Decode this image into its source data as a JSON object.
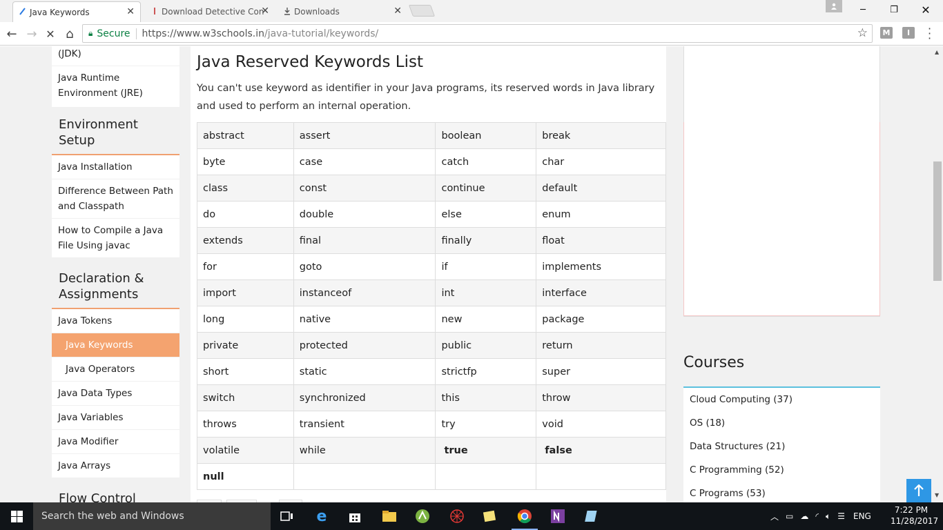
{
  "browser": {
    "tabs": [
      {
        "title": "Java Keywords",
        "active": true
      },
      {
        "title": "Download Detective Con",
        "active": false
      },
      {
        "title": "Downloads",
        "active": false
      }
    ],
    "security_label": "Secure",
    "url_host": "https://www.w3schools.in",
    "url_path": "/java-tutorial/keywords/",
    "extensions": [
      "M",
      "I"
    ]
  },
  "sidebar": {
    "top_items": [
      "(JDK)",
      "Java Runtime Environment (JRE)"
    ],
    "sections": [
      {
        "heading": "Environment Setup",
        "items": [
          "Java Installation",
          "Difference Between Path and Classpath",
          "How to Compile a Java File Using javac"
        ]
      },
      {
        "heading": "Declaration & Assignments",
        "items": [
          "Java Tokens",
          "Java Keywords",
          "Java Operators",
          "Java Data Types",
          "Java Variables",
          "Java Modifier",
          "Java Arrays"
        ]
      },
      {
        "heading": "Flow Control",
        "items": []
      }
    ]
  },
  "article": {
    "title": "Java Reserved Keywords List",
    "intro": "You can't use keyword as identifier in your Java programs, its reserved words in Java library and used to perform an internal operation.",
    "keywords_table": [
      [
        "abstract",
        "assert",
        "boolean",
        "break"
      ],
      [
        "byte",
        "case",
        "catch",
        "char"
      ],
      [
        "class",
        "const",
        "continue",
        "default"
      ],
      [
        "do",
        "double",
        "else",
        "enum"
      ],
      [
        "extends",
        "final",
        "finally",
        "float"
      ],
      [
        "for",
        "goto",
        "if",
        "implements"
      ],
      [
        "import",
        "instanceof",
        "int",
        "interface"
      ],
      [
        "long",
        "native",
        "new",
        "package"
      ],
      [
        "private",
        "protected",
        "public",
        "return"
      ],
      [
        "short",
        "static",
        "strictfp",
        "super"
      ],
      [
        "switch",
        "synchronized",
        "this",
        "throw"
      ],
      [
        "throws",
        "transient",
        "try",
        "void"
      ],
      [
        "volatile",
        "while",
        "true",
        "false"
      ],
      [
        "null",
        "",
        "",
        ""
      ]
    ]
  },
  "courses": {
    "title": "Courses",
    "items": [
      "Cloud Computing (37)",
      "OS (18)",
      "Data Structures (21)",
      "C Programming (52)",
      "C Programs (53)"
    ]
  },
  "taskbar": {
    "search_placeholder": "Search the web and Windows",
    "language": "ENG",
    "time": "7:22 PM",
    "date": "11/28/2017"
  }
}
